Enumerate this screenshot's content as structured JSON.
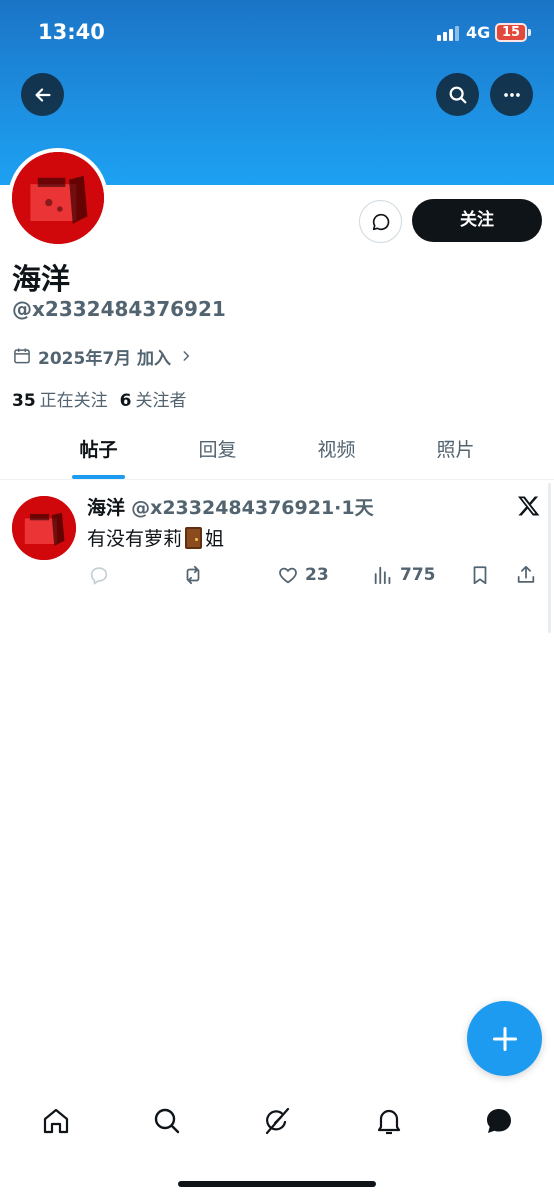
{
  "status_bar": {
    "time": "13:40",
    "network": "4G",
    "battery": "15"
  },
  "profile": {
    "display_name": "海洋",
    "handle": "@x2332484376921",
    "joined": "2025年7月 加入",
    "follow_button": "关注",
    "following_count": "35",
    "following_label": "正在关注",
    "followers_count": "6",
    "followers_label": "关注者"
  },
  "tabs": [
    {
      "label": "帖子",
      "active": true
    },
    {
      "label": "回复",
      "active": false
    },
    {
      "label": "视频",
      "active": false
    },
    {
      "label": "照片",
      "active": false
    }
  ],
  "post": {
    "name": "海洋",
    "meta": "@x2332484376921·1天",
    "text_before": "有没有萝莉",
    "text_after": "姐",
    "emoji": "door",
    "likes": "23",
    "views": "775"
  },
  "colors": {
    "accent": "#1d9bf0",
    "text": "#0f1419",
    "muted": "#536471",
    "avatar": "#d60b10"
  },
  "icons": [
    "back-arrow-icon",
    "search-icon",
    "more-icon",
    "message-icon",
    "calendar-icon",
    "chevron-right-icon",
    "x-logo-icon",
    "reply-icon",
    "repost-icon",
    "like-icon",
    "views-icon",
    "bookmark-icon",
    "share-icon",
    "compose-plus-icon",
    "home-icon",
    "explore-icon",
    "grok-icon",
    "notifications-icon",
    "messages-icon"
  ]
}
